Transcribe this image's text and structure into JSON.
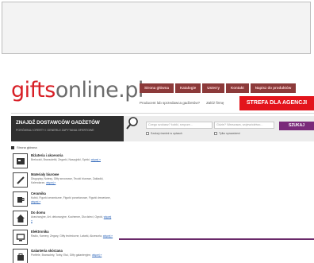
{
  "logo": {
    "part1": "gifts",
    "part2": "online.pl"
  },
  "nav": {
    "tabs": [
      "Strona główna",
      "Katalogie",
      "Usterry",
      "Kontakt",
      "Napisz do produktów"
    ],
    "sub": [
      "Producent lub sprzedawca gadżetów?",
      "Załóż firmę"
    ]
  },
  "strefa": "STREFA DLA AGENCJI",
  "search": {
    "headline": "ZNAJDŹ DOSTAWCÓW GADŻETÓW",
    "subline": "PORÓWNUJ OFERTY I GENERUJ ZAPYTANIA OFERTOWE",
    "query_placeholder": "Czego szukasz? kubki, smycze...",
    "location_placeholder": "Gdzie? Warszawa, województwo...",
    "check1": "Szukaj również w opisach",
    "check2": "Tylko sprawdzeni",
    "button": "SZUKAJ"
  },
  "breadcrumb": "Strona główna",
  "categories": [
    {
      "title": "Biżuteria i akcesoria",
      "desc": "Breloczki, Bransoletki, Zegarki, Naszyjniki, Spinki,",
      "more": "więcej »",
      "icon": "card-icon"
    },
    {
      "title": "Materiały biurowe",
      "desc": "Długopisy, Notesy, Gifty sezonowe, Teczki biurowe, Zakładki, Kalendarze,",
      "more": "więcej »",
      "icon": "pen-icon"
    },
    {
      "title": "Ceramika",
      "desc": "Kubki, Figurki ceramiczne, Figurki porcelanowe, Figurki drewniane,",
      "more": "więcej »",
      "icon": "mug-icon"
    },
    {
      "title": "Do domu",
      "desc": "Aranżacyjne, Art. dekoracyjne, Kuchenne, Dla dzieci, Ogród,",
      "more": "więcej »",
      "icon": "house-icon"
    },
    {
      "title": "Elektronika",
      "desc": "Radio, Kamery, Zegary, Gifty techniczne, Latarki, Akcesoria,",
      "more": "więcej »",
      "icon": "monitor-icon"
    },
    {
      "title": "Galanteria skórzana",
      "desc": "Portfele, Bransolety, Torby, Etui, Gifty galanteryjne,",
      "more": "więcej »",
      "icon": "bag-icon"
    }
  ],
  "colors": {
    "brand_red": "#d81f26",
    "nav_bg": "#8c3a3a",
    "strefa_bg": "#e3141c",
    "search_dark": "#2f2f2f",
    "button_purple": "#7a2a7a"
  }
}
